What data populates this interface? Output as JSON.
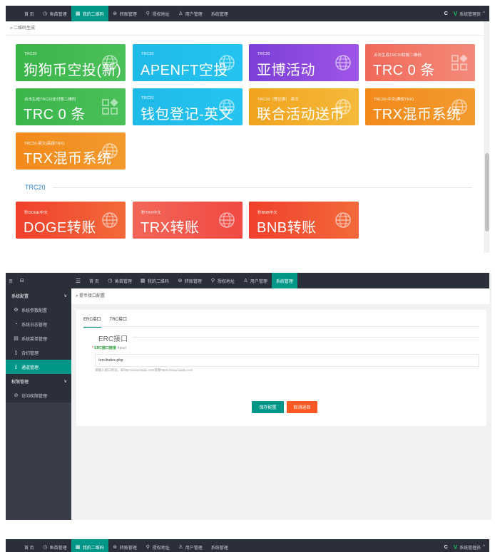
{
  "nav": {
    "items": [
      {
        "label": "首 页",
        "icon": ""
      },
      {
        "label": "鱼苗管理",
        "icon": "clock-icon"
      },
      {
        "label": "我的二维码",
        "icon": "qr-icon"
      },
      {
        "label": "转账管理",
        "icon": "transfer-icon"
      },
      {
        "label": "授权地址",
        "icon": "pin-icon"
      },
      {
        "label": "用户管理",
        "icon": "user-icon"
      },
      {
        "label": "系统管理",
        "icon": ""
      }
    ],
    "refresh_icon": "C",
    "logo_letter": "V",
    "admin_label": "系统管理员"
  },
  "screen1": {
    "breadcrumb": "» 二维码生成",
    "tiles": [
      {
        "small": "TRC20",
        "big": "狗狗币空投(新)",
        "color": "g-green",
        "icon": "globe-icon"
      },
      {
        "small": "TRC20",
        "big": "APENFT空投",
        "color": "g-cyan",
        "icon": "globe-icon"
      },
      {
        "small": "TRC20",
        "big": "亚博活动",
        "color": "g-purple",
        "icon": "globe-icon"
      },
      {
        "small": "点击生成TRC20转账二维码",
        "big": "TRC 0 条",
        "color": "g-salmon",
        "icon": "grid-icon"
      },
      {
        "small": "点击生成TRC20支付账二维码",
        "big": "TRC 0 条",
        "color": "g-green",
        "icon": "grid-icon"
      },
      {
        "small": "TRC20",
        "big": "钱包登记-英文",
        "color": "g-cyan",
        "icon": "globe-icon"
      },
      {
        "small": "TRC20（登记表）-英文",
        "big": "联合活动送币",
        "color": "g-yellow",
        "icon": "globe-icon"
      },
      {
        "small": "TRC20-中文(典权TRX)",
        "big": "TRX混币系统",
        "color": "g-orange",
        "icon": "globe-icon"
      },
      {
        "small": "TRC20-英文(高级TRX)",
        "big": "TRX混币系统",
        "color": "g-orange",
        "icon": "globe-icon"
      }
    ],
    "section_title": "TRC20",
    "tiles2": [
      {
        "small": "秒DOGE中文",
        "big": "DOGE转账",
        "color": "g-red",
        "icon": "globe-icon"
      },
      {
        "small": "秒TRX中文",
        "big": "TRX转账",
        "color": "g-pinkred",
        "icon": "globe-icon"
      },
      {
        "small": "秒BNB中文",
        "big": "BNB转账",
        "color": "g-red",
        "icon": "globe-icon"
      }
    ]
  },
  "screen2": {
    "top_left": "页",
    "top_nav": [
      "首 页",
      "鱼苗管理",
      "我的二维码",
      "转账管理",
      "授权地址",
      "用户管理",
      "系统管理"
    ],
    "sidebar": [
      {
        "label": "系统配置",
        "type": "group",
        "arrow": "∨"
      },
      {
        "label": "系统参数配置",
        "type": "sub",
        "icon": "gear-icon"
      },
      {
        "label": "系统日志管理",
        "type": "sub",
        "icon": "log-icon"
      },
      {
        "label": "系统菜单管理",
        "type": "sub",
        "icon": "menu-icon"
      },
      {
        "label": "合约管理",
        "type": "sub",
        "icon": "contract-icon"
      },
      {
        "label": "通道管理",
        "type": "sub",
        "icon": "channel-icon",
        "active": true
      },
      {
        "label": "权限管理",
        "type": "group",
        "arrow": "∨"
      },
      {
        "label": "访问权限管理",
        "type": "sub",
        "icon": "lock-icon"
      }
    ],
    "breadcrumb": "» 提币接口配置",
    "tabs": [
      "ERC接口",
      "TRC接口"
    ],
    "legend": "ERC接口",
    "field_req": "*",
    "field_code": "ERC接口链接",
    "field_name": "Apiurl",
    "field_value": "/erc/index.php",
    "field_hint": "请输入接口地址，如http://www.baidu.com或者https://www.baidu.com",
    "save_label": "保存配置",
    "back_label": "取消返回"
  }
}
